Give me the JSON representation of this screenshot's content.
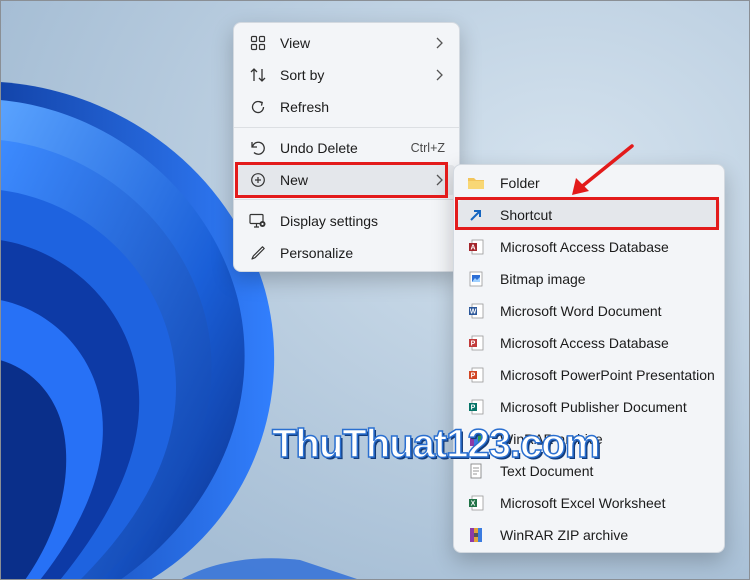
{
  "main_menu": {
    "items": [
      {
        "label": "View",
        "icon": "grid-view-icon",
        "has_submenu": true
      },
      {
        "label": "Sort by",
        "icon": "sort-arrows-icon",
        "has_submenu": true
      },
      {
        "label": "Refresh",
        "icon": "refresh-icon",
        "has_submenu": false
      },
      {
        "label": "Undo Delete",
        "icon": "undo-icon",
        "shortcut": "Ctrl+Z",
        "has_submenu": false
      },
      {
        "label": "New",
        "icon": "plus-circle-icon",
        "has_submenu": true,
        "highlighted": true
      },
      {
        "label": "Display settings",
        "icon": "display-settings-icon",
        "has_submenu": false
      },
      {
        "label": "Personalize",
        "icon": "pen-icon",
        "has_submenu": false
      }
    ]
  },
  "new_submenu": {
    "items": [
      {
        "label": "Folder",
        "icon": "folder-icon"
      },
      {
        "label": "Shortcut",
        "icon": "shortcut-arrow-icon",
        "highlighted": true
      },
      {
        "label": "Microsoft Access Database",
        "icon": "access-icon"
      },
      {
        "label": "Bitmap image",
        "icon": "bitmap-icon"
      },
      {
        "label": "Microsoft Word Document",
        "icon": "word-icon"
      },
      {
        "label": "Microsoft Access Database",
        "icon": "access-icon"
      },
      {
        "label": "Microsoft PowerPoint Presentation",
        "icon": "powerpoint-icon"
      },
      {
        "label": "Microsoft Publisher Document",
        "icon": "publisher-icon"
      },
      {
        "label": "WinRAR archive",
        "icon": "winrar-icon"
      },
      {
        "label": "Text Document",
        "icon": "text-document-icon"
      },
      {
        "label": "Microsoft Excel Worksheet",
        "icon": "excel-icon"
      },
      {
        "label": "WinRAR ZIP archive",
        "icon": "winrar-zip-icon"
      }
    ]
  },
  "watermark": {
    "text": "ThuThuat123.com"
  },
  "colors": {
    "annotation_red": "#e31b1b",
    "menu_bg": "#f3f5f8",
    "highlight": "#e4e7eb",
    "bloom_blue": "#1a5fd8"
  }
}
